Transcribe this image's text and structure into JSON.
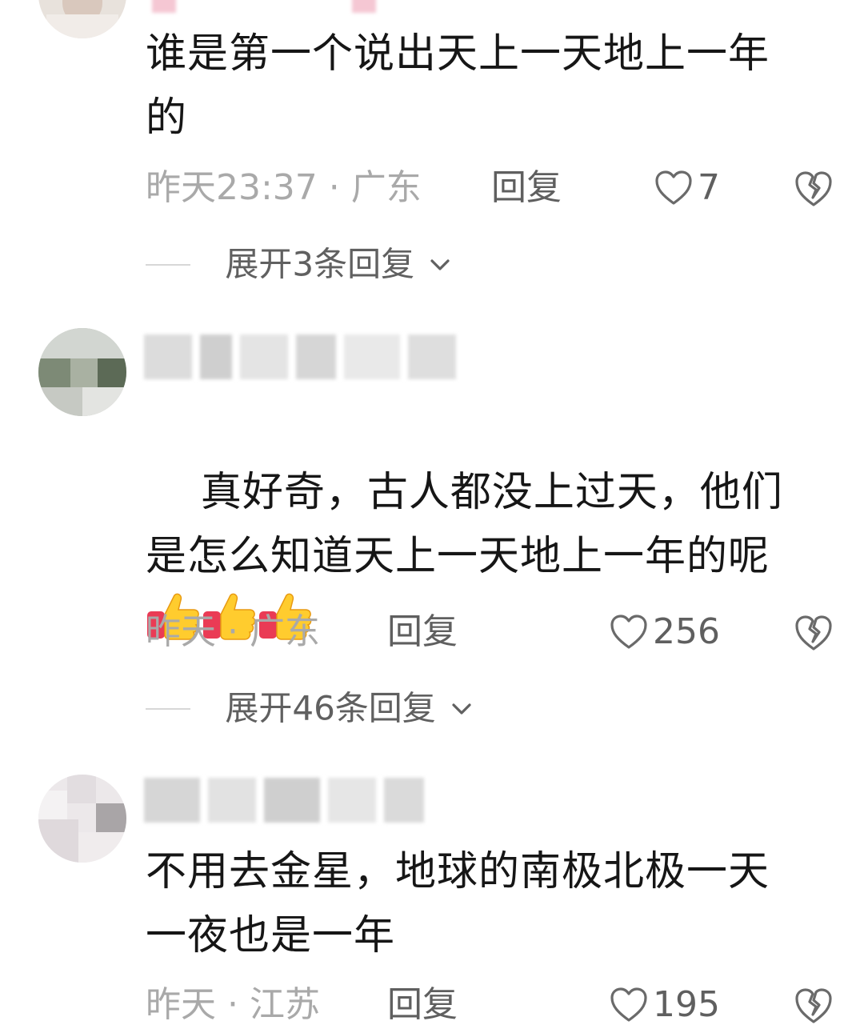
{
  "comments": [
    {
      "text": "谁是第一个说出天上一天地上一年的",
      "time_location": "昨天23:37 · 广东",
      "reply_label": "回复",
      "likes": "7",
      "expand_label": "展开3条回复"
    },
    {
      "text": "真好奇，古人都没上过天，他们是怎么知道天上一天地上一年的呢",
      "emoji": [
        "thumbs-up",
        "thumbs-up",
        "thumbs-up"
      ],
      "time_location": "昨天 · 广东",
      "reply_label": "回复",
      "likes": "256",
      "expand_label": "展开46条回复"
    },
    {
      "text": "不用去金星，地球的南极北极一天一夜也是一年",
      "time_location": "昨天 · 江苏",
      "reply_label": "回复",
      "likes": "195"
    }
  ],
  "colors": {
    "text": "#161616",
    "meta": "#a9a9a9",
    "action": "#5f5f5f",
    "divider": "#d7d7d7"
  },
  "icons": [
    "heart-outline-icon",
    "broken-heart-icon",
    "chevron-down-icon",
    "thumbs-up-emoji"
  ]
}
